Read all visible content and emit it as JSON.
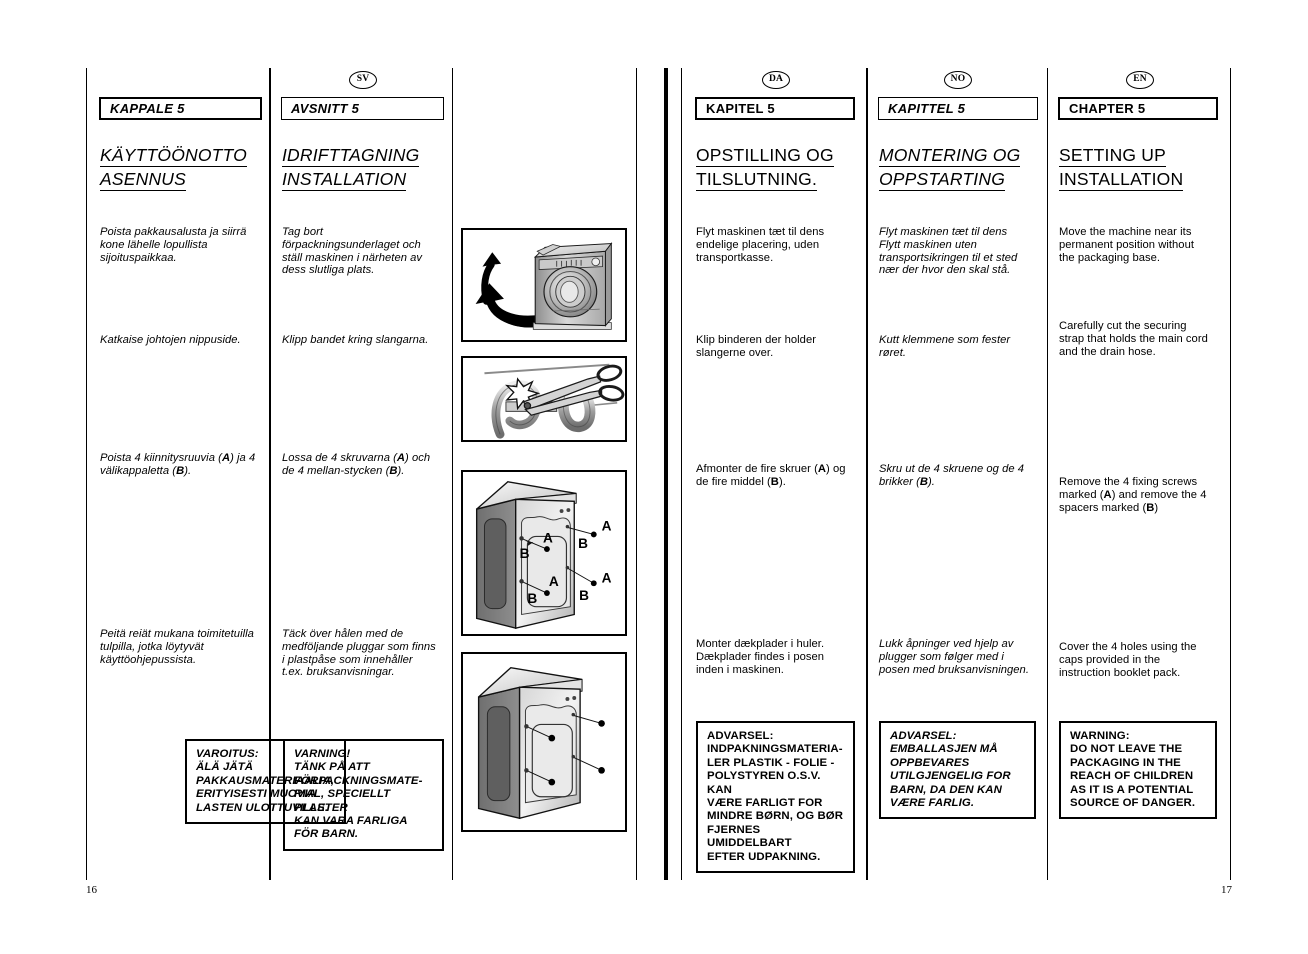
{
  "document": {
    "type": "washing-machine-instruction-manual",
    "spread": "two-page multilingual manual spread",
    "left_page_number": "16",
    "right_page_number": "17"
  },
  "columns": [
    {
      "id": "fi",
      "language_badge": "",
      "chapter_label": "KAPPALE 5",
      "heading_lines": [
        "KÄYTTÖÖNOTTO",
        "ASENNUS"
      ],
      "paragraphs": [
        "Poista pakkausalusta ja siirrä kone lähelle lopullista sijoituspaikkaa.",
        "Katkaise johtojen nippuside.",
        "Poista  4 kiinnitysruuvia (A) ja 4 välikappaletta (B).",
        "Peitä reiät mukana toimitetuilla tulpilla, jotka löytyvät  käyttöohjepussista."
      ],
      "warning_lines": [
        "VAROITUS:",
        "ÄLÄ JÄTÄ",
        "PAKKAUSMATERIAALIA,",
        "ERITYISESTI MUOVIA",
        "LASTEN ULOTTUVILLE."
      ]
    },
    {
      "id": "sv",
      "language_badge": "SV",
      "chapter_label": "AVSNITT 5",
      "heading_lines": [
        "IDRIFTTAGNING",
        "INSTALLATION"
      ],
      "paragraphs": [
        "Tag bort förpackningsunderlaget och ställ maskinen i närheten av dess slutliga plats.",
        "Klipp bandet kring slangarna.",
        "Lossa de 4 skruvarna (A) och de 4 mellan-stycken (B).",
        " Täck över hålen med de medföljande pluggar som finns i plastpåse som innehåller t.ex. bruksanvisningar."
      ],
      "warning_lines": [
        "VARNING!",
        "TÄNK PÅ ATT",
        "FÖRPACKNINGSMATE-",
        "RIAL, SPECIELLT PLASTER",
        "KAN VARA FARLIGA",
        "FÖR BARN."
      ]
    },
    {
      "id": "da",
      "language_badge": "DA",
      "chapter_label": "KAPITEL 5",
      "heading_lines": [
        "OPSTILLING OG",
        "TILSLUTNING."
      ],
      "paragraphs": [
        "Flyt maskinen tæt til dens endelige placering, uden transportkasse.",
        "Klip binderen der holder slangerne over.",
        "Afmonter de fire skruer (A) og de fire middel (B).",
        "Monter dækplader i huler. Dækplader findes i posen inden i maskinen."
      ],
      "warning_lines": [
        "ADVARSEL:",
        "INDPAKNINGSMATERIA-",
        "LER PLASTIK - FOLIE -",
        "POLYSTYREN O.S.V. KAN",
        "VÆRE FARLIGT FOR",
        "MINDRE BØRN, OG BØR",
        "FJERNES UMIDDELBART",
        "EFTER UDPAKNING."
      ]
    },
    {
      "id": "no",
      "language_badge": "NO",
      "chapter_label": "KAPITTEL 5",
      "heading_lines": [
        "MONTERING OG",
        "OPPSTARTING"
      ],
      "paragraphs": [
        "Flyt maskinen tæt til dens Flytt maskinen uten transportsikringen til et sted nær der hvor den skal stå.",
        "Kutt klemmene som fester røret.",
        "Skru ut de 4 skruene og de 4 brikker (B).",
        "Lukk åpninger ved hjelp av plugger som følger med i posen med bruksanvisningen."
      ],
      "warning_lines": [
        "ADVARSEL:",
        "EMBALLASJEN MÅ",
        "OPPBEVARES",
        "UTILGJENGELIG FOR",
        "BARN, DA DEN KAN",
        "VÆRE FARLIG."
      ]
    },
    {
      "id": "en",
      "language_badge": "EN",
      "chapter_label": "CHAPTER 5",
      "heading_lines": [
        "SETTING UP",
        "INSTALLATION"
      ],
      "paragraphs": [
        "Move the machine near its permanent position without the packaging base.",
        "Carefully cut the securing strap that holds the main cord and the drain hose.",
        "Remove the 4 fixing screws marked (A) and remove the 4 spacers marked (B)",
        "Cover the 4 holes using the caps provided in the instruction booklet pack."
      ],
      "warning_lines": [
        "WARNING:",
        "DO NOT LEAVE THE",
        "PACKAGING IN THE",
        "REACH OF CHILDREN",
        "AS IT IS A POTENTIAL",
        "SOURCE OF DANGER."
      ]
    }
  ],
  "figures": [
    {
      "id": "fig-move-machine",
      "name": "washing-machine-with-arrow",
      "description": "Front view of washing machine on packaging base with curved arrow indicating moving it off the base"
    },
    {
      "id": "fig-cut-strap",
      "name": "scissors-cutting-strap",
      "description": "Scissors cutting the securing strap holding the hoses and cord"
    },
    {
      "id": "fig-remove-screws",
      "name": "rear-panel-screws-ab",
      "description": "Rear view of machine showing 4 transit screws marked A and 4 spacers marked B",
      "labels": [
        "A",
        "B",
        "A",
        "B",
        "A",
        "B",
        "A",
        "B"
      ]
    },
    {
      "id": "fig-fit-caps",
      "name": "rear-panel-caps",
      "description": "Rear view of machine with the 4 holes covered by caps"
    }
  ]
}
